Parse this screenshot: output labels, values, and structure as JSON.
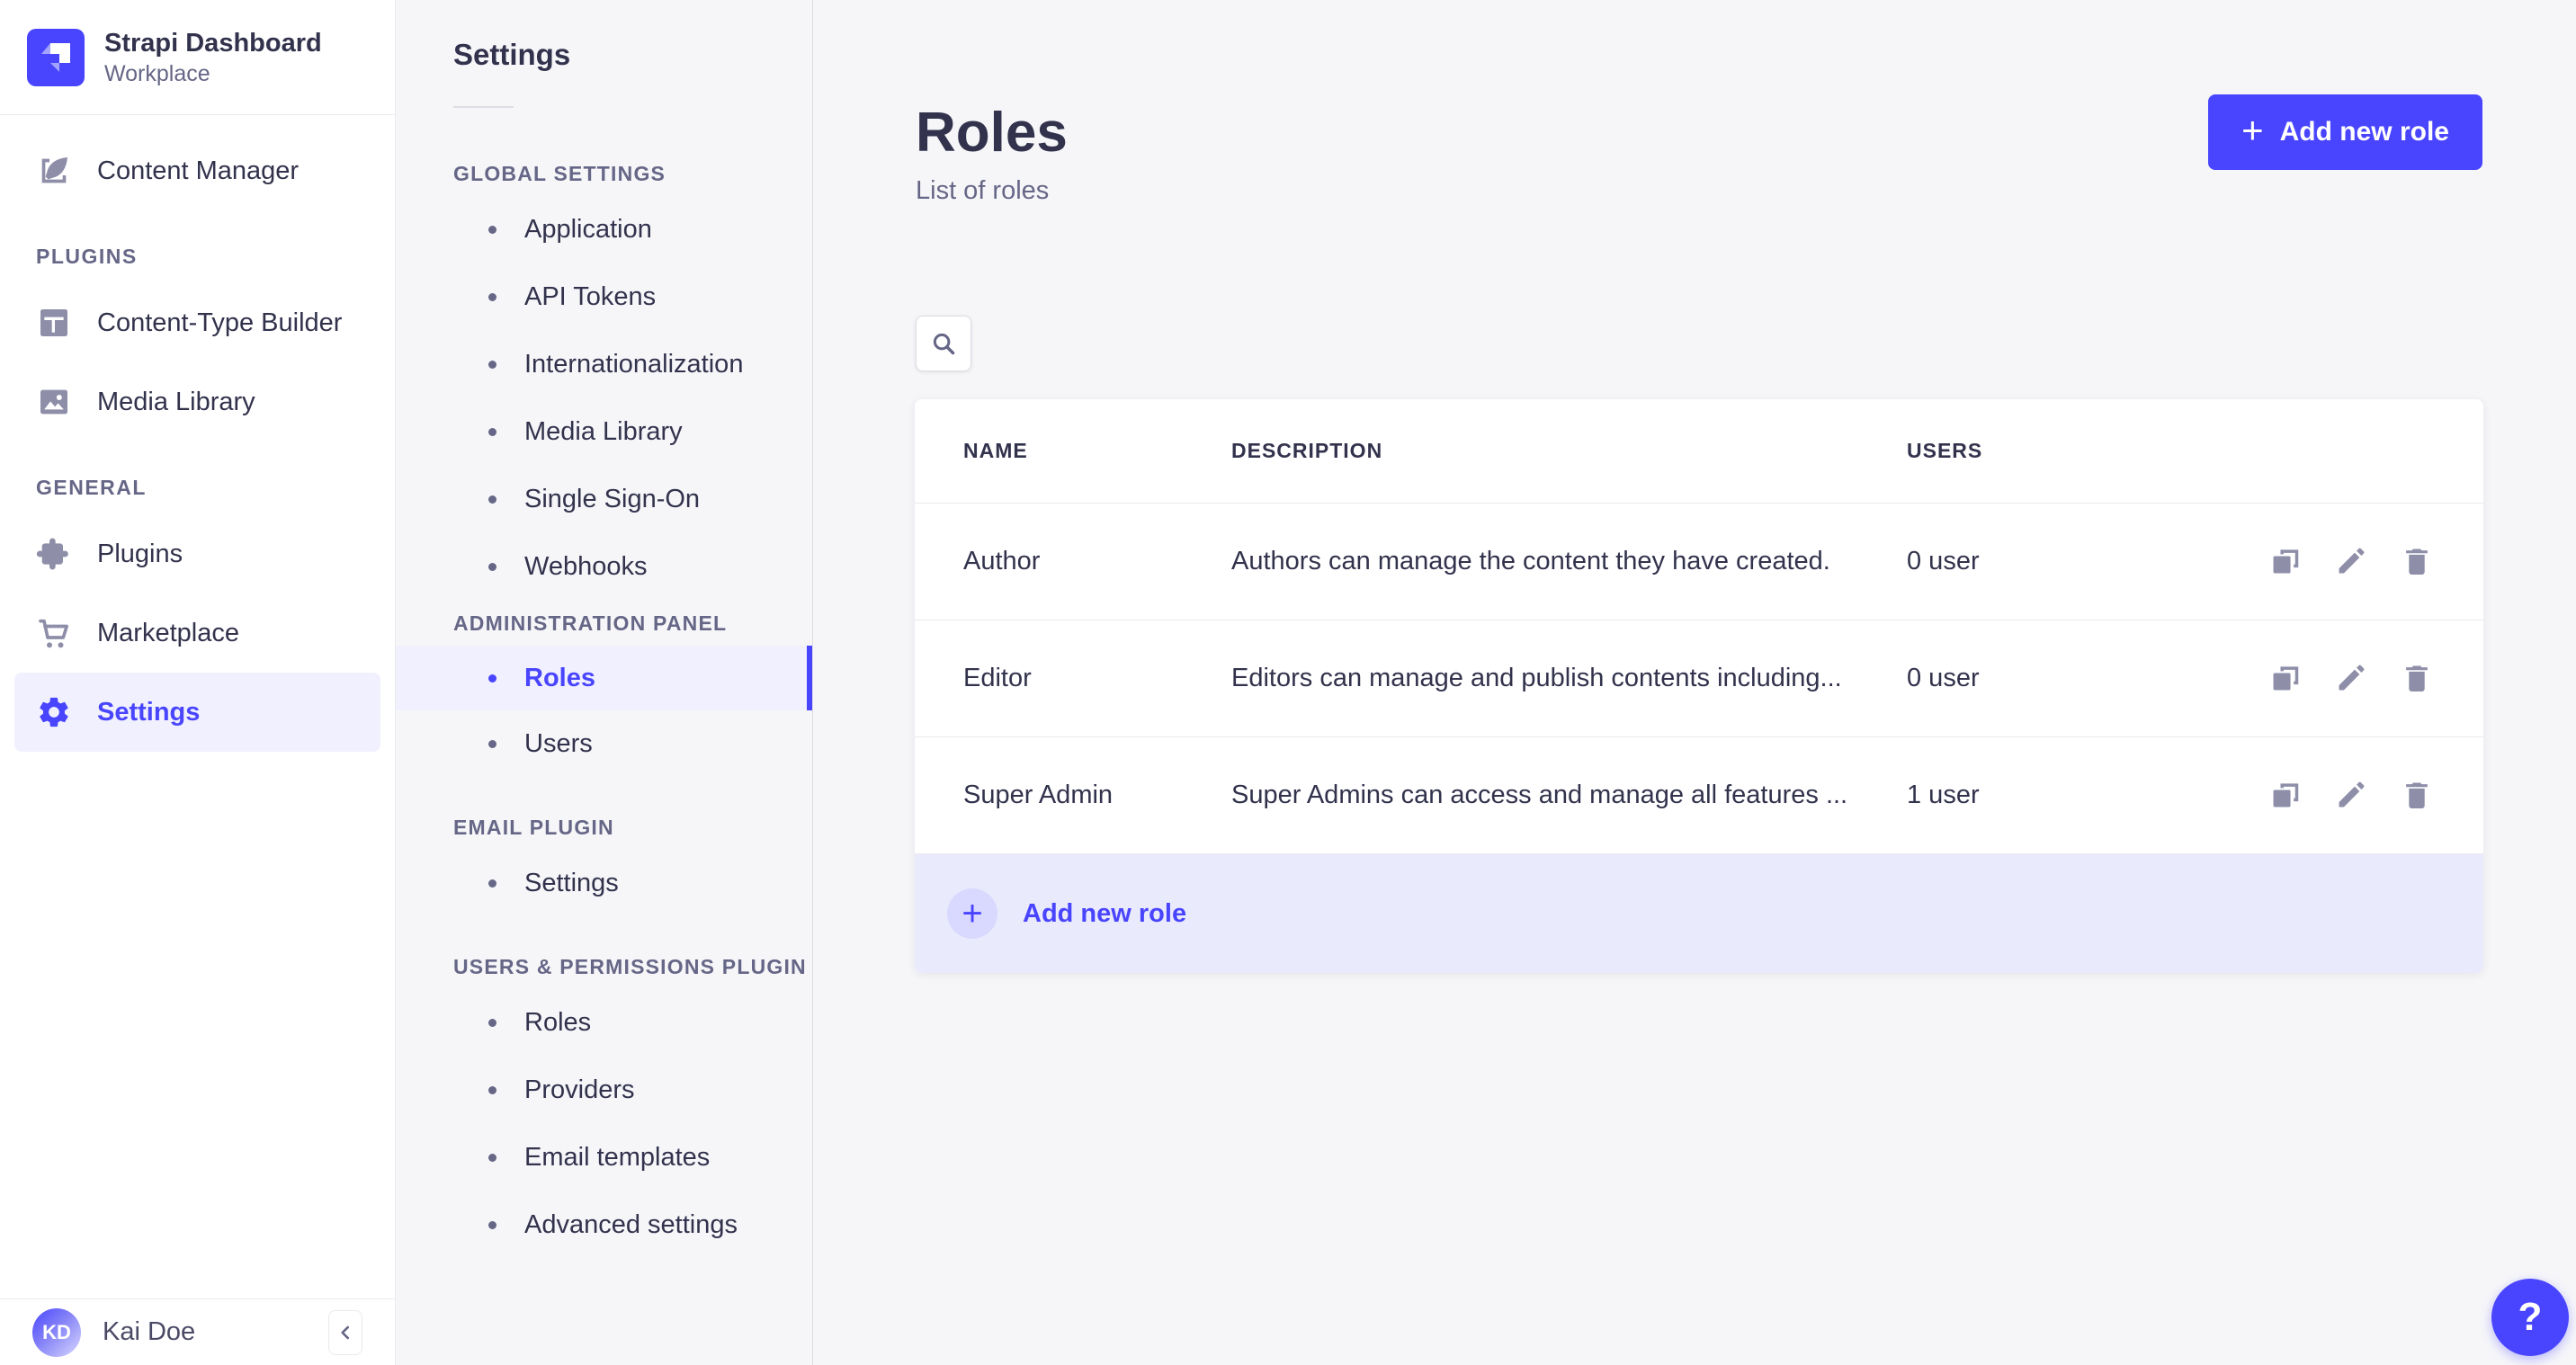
{
  "brand": {
    "title": "Strapi Dashboard",
    "subtitle": "Workplace"
  },
  "sidebar": {
    "primary": [
      {
        "icon": "content-manager-icon",
        "label": "Content Manager"
      }
    ],
    "sections": [
      {
        "label": "PLUGINS",
        "items": [
          {
            "icon": "content-type-builder-icon",
            "label": "Content-Type Builder"
          },
          {
            "icon": "media-library-icon",
            "label": "Media Library"
          }
        ]
      },
      {
        "label": "GENERAL",
        "items": [
          {
            "icon": "plugins-icon",
            "label": "Plugins"
          },
          {
            "icon": "marketplace-icon",
            "label": "Marketplace"
          },
          {
            "icon": "settings-icon",
            "label": "Settings",
            "active": true
          }
        ]
      }
    ],
    "user": {
      "initials": "KD",
      "name": "Kai Doe"
    }
  },
  "subsidebar": {
    "title": "Settings",
    "sections": [
      {
        "label": "GLOBAL SETTINGS",
        "items": [
          "Application",
          "API Tokens",
          "Internationalization",
          "Media Library",
          "Single Sign-On",
          "Webhooks"
        ]
      },
      {
        "label": "ADMINISTRATION PANEL",
        "items": [
          "Roles",
          "Users"
        ],
        "active_item": "Roles"
      },
      {
        "label": "EMAIL PLUGIN",
        "items": [
          "Settings"
        ]
      },
      {
        "label": "USERS & PERMISSIONS PLUGIN",
        "items": [
          "Roles",
          "Providers",
          "Email templates",
          "Advanced settings"
        ]
      }
    ]
  },
  "main": {
    "title": "Roles",
    "subtitle": "List of roles",
    "add_button_label": "Add new role",
    "add_button_plus": "+",
    "table": {
      "columns": [
        "NAME",
        "DESCRIPTION",
        "USERS"
      ],
      "rows": [
        {
          "name": "Author",
          "description": "Authors can manage the content they have created.",
          "users": "0 user"
        },
        {
          "name": "Editor",
          "description": "Editors can manage and publish contents including...",
          "users": "0 user"
        },
        {
          "name": "Super Admin",
          "description": "Super Admins can access and manage all features ...",
          "users": "1 user"
        }
      ],
      "row_actions": [
        "duplicate",
        "edit",
        "delete"
      ],
      "footer_add_label": "Add new role",
      "footer_add_plus": "+"
    },
    "help_label": "?"
  },
  "colors": {
    "accent": "#4945ff",
    "accent_light": "#f0f0ff",
    "footer_bar": "#eaeafd",
    "background": "#f6f6f9",
    "surface": "#ffffff",
    "border": "#dcdce4",
    "divider": "#eaeaef",
    "text_primary": "#32324d",
    "text_secondary": "#666687",
    "icon_muted": "#8e8ea9"
  }
}
